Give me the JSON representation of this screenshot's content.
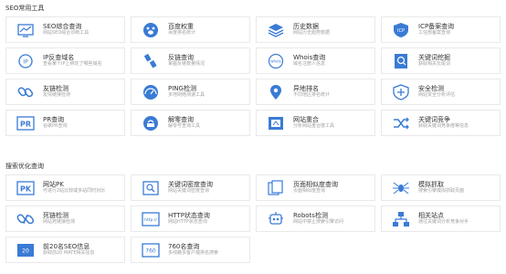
{
  "sections": [
    {
      "title": "SEO常用工具",
      "items": [
        {
          "title": "SEO综合查询",
          "desc": "网站SEO综合诊断工具",
          "icon": "seo-monitor-icon"
        },
        {
          "title": "百度权重",
          "desc": "百度排名统计",
          "icon": "baidu-paw-icon"
        },
        {
          "title": "历史数据",
          "desc": "网站历史趋势数据",
          "icon": "history-data-icon"
        },
        {
          "title": "ICP备案查询",
          "desc": "工信部备案查询",
          "icon": "icp-shield-icon"
        },
        {
          "title": "IP反查域名",
          "desc": "查看某个IP上绑定了哪些域名",
          "icon": "ip-lookup-icon"
        },
        {
          "title": "反链查询",
          "desc": "掌握反链数量情况",
          "icon": "backlink-icon"
        },
        {
          "title": "Whois查询",
          "desc": "域名注册人信息",
          "icon": "whois-icon"
        },
        {
          "title": "关键词挖掘",
          "desc": "获取相关长尾词",
          "icon": "keyword-mining-icon"
        },
        {
          "title": "友链检测",
          "desc": "友情链接检测",
          "icon": "friend-link-icon"
        },
        {
          "title": "PING检测",
          "desc": "多地网络测速工具",
          "icon": "ping-gauge-icon"
        },
        {
          "title": "异地排名",
          "desc": "不同地区排名统计",
          "icon": "location-pin-icon"
        },
        {
          "title": "安全检测",
          "desc": "网站安全分析评估",
          "icon": "security-shield-icon"
        },
        {
          "title": "PR查询",
          "desc": "谷歌PR查询",
          "icon": "pr-icon"
        },
        {
          "title": "解零查询",
          "desc": "解零号查询工具",
          "icon": "resolve-query-icon"
        },
        {
          "title": "网站重合",
          "desc": "分析网站重合度工具",
          "icon": "site-overlap-icon"
        },
        {
          "title": "关键词竞争",
          "desc": "获取关键词竞争度等信息",
          "icon": "shuffle-icon"
        }
      ]
    },
    {
      "title": "搜索优化查询",
      "items": [
        {
          "title": "网站PK",
          "desc": "可进行2站比较或多站同时对比",
          "icon": "pk-icon"
        },
        {
          "title": "关键词密度查询",
          "desc": "网站关键词密度查询",
          "icon": "keyword-density-icon"
        },
        {
          "title": "页面相似度查询",
          "desc": "页面相似度查询",
          "icon": "page-similarity-icon"
        },
        {
          "title": "模拟抓取",
          "desc": "搜索引擎模拟抓取页面",
          "icon": "spider-icon"
        },
        {
          "title": "死链检测",
          "desc": "网站死链接检测",
          "icon": "dead-link-icon"
        },
        {
          "title": "HTTP状态查询",
          "desc": "网站HTTP状态查询",
          "icon": "http-icon"
        },
        {
          "title": "Robots检测",
          "desc": "网站中禁止搜索引擎访问",
          "icon": "robot-icon"
        },
        {
          "title": "相关站点",
          "desc": "通过关键词分析竞争对手",
          "icon": "sitemap-icon"
        },
        {
          "title": "前20名SEO信息",
          "desc": "获取前20 MATE相关信息",
          "icon": "top20-icon"
        },
        {
          "title": "760名查询",
          "desc": "多线路多客户端排名搜索",
          "icon": "rank760-icon"
        }
      ]
    }
  ]
}
